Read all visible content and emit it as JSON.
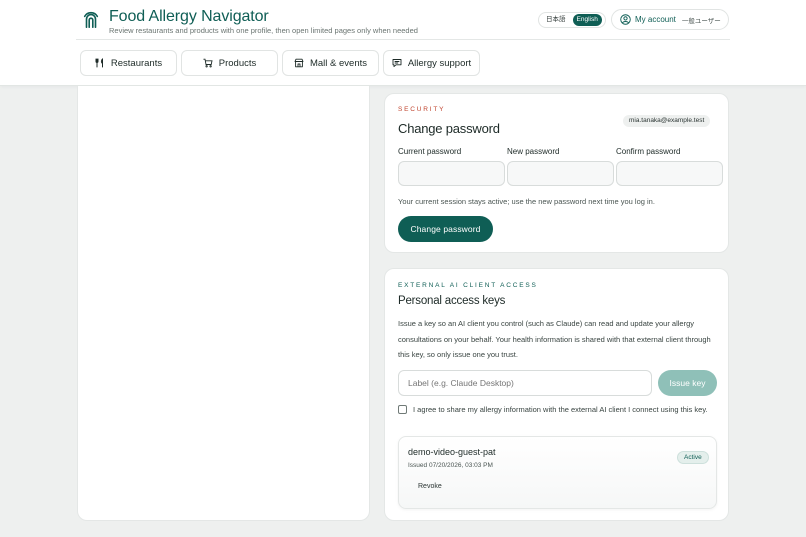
{
  "brand": {
    "title": "Food Allergy Navigator",
    "subtitle": "Review restaurants and products with one profile, then open limited pages only when needed"
  },
  "language": {
    "options": [
      "日本語",
      "English"
    ],
    "selected": "English"
  },
  "account": {
    "label": "My account",
    "role": "一般ユーザー"
  },
  "nav": [
    {
      "label": "Restaurants",
      "icon": "utensils-icon"
    },
    {
      "label": "Products",
      "icon": "cart-icon"
    },
    {
      "label": "Mall & events",
      "icon": "store-icon"
    },
    {
      "label": "Allergy support",
      "icon": "chat-icon"
    }
  ],
  "password_card": {
    "eyebrow": "SECURITY",
    "title": "Change password",
    "email": "mia.tanaka@example.test",
    "fields": {
      "current": {
        "label": "Current password",
        "value": ""
      },
      "new": {
        "label": "New password",
        "value": ""
      },
      "confirm": {
        "label": "Confirm password",
        "value": ""
      }
    },
    "hint": "Your current session stays active; use the new password next time you log in.",
    "submit_label": "Change password"
  },
  "keys_card": {
    "eyebrow": "EXTERNAL AI CLIENT ACCESS",
    "title": "Personal access keys",
    "description": "Issue a key so an AI client you control (such as Claude) can read and update your allergy consultations on your behalf. Your health information is shared with that external client through this key, so only issue one you trust.",
    "label_placeholder": "Label (e.g. Claude Desktop)",
    "issue_label": "Issue key",
    "agree_text": "I agree to share my allergy information with the external AI client I connect using this key.",
    "agree_checked": false,
    "keys": [
      {
        "name": "demo-video-guest-pat",
        "issued": "Issued 07/20/2026, 03:03 PM",
        "status": "Active",
        "revoke_label": "Revoke"
      }
    ]
  },
  "colors": {
    "brand": "#0f5e55",
    "accent_red": "#c0442e",
    "disabled_button": "#8fc0b8",
    "background": "#eef0ef"
  }
}
